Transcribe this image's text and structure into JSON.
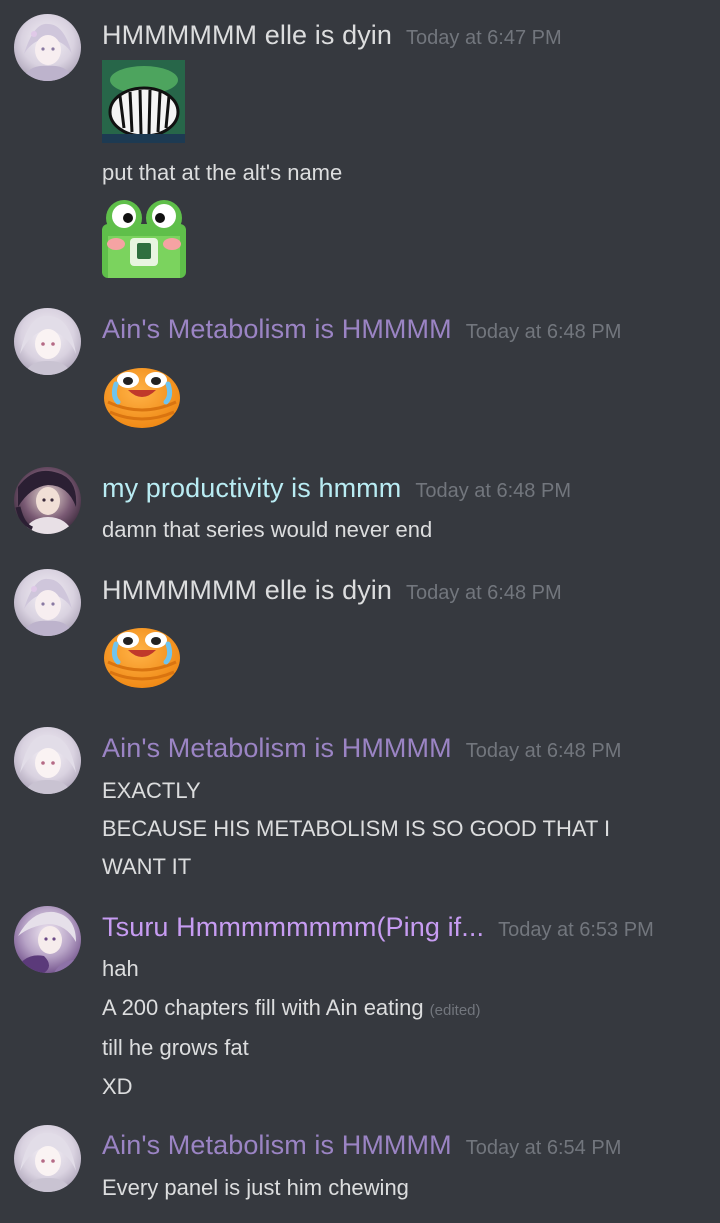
{
  "colors": {
    "background": "#36393f",
    "name_white": "#dcddde",
    "name_purple": "#9b84c4",
    "name_cyan": "#b9ecf3",
    "name_lilac": "#c79cf2",
    "timestamp": "#72767d"
  },
  "messages": [
    {
      "author": "HMMMMMM elle is dyin",
      "timestamp": "Today at 6:47 PM",
      "caption": "put that at the alt's name",
      "emojis": [
        "grimacing-pepe-emoji",
        "shocked-frog-emoji"
      ]
    },
    {
      "author": "Ain's Metabolism is HMMMM",
      "timestamp": "Today at 6:48 PM",
      "emojis": [
        "crying-laughing-blob-emoji"
      ]
    },
    {
      "author": "my productivity is hmmm",
      "timestamp": "Today at 6:48 PM",
      "lines": [
        "damn that series would never end"
      ]
    },
    {
      "author": "HMMMMMM elle is dyin",
      "timestamp": "Today at 6:48 PM",
      "emojis": [
        "crying-laughing-blob-emoji"
      ]
    },
    {
      "author": "Ain's Metabolism is HMMMM",
      "timestamp": "Today at 6:48 PM",
      "lines": [
        "EXACTLY",
        "BECAUSE HIS METABOLISM IS SO GOOD THAT I",
        "WANT IT"
      ]
    },
    {
      "author": "Tsuru Hmmmmmmmm(Ping if...",
      "timestamp": "Today at 6:53 PM",
      "lines": [
        "hah",
        "A 200 chapters fill with Ain eating",
        "till he grows fat",
        "XD"
      ],
      "edited_label": "(edited)"
    },
    {
      "author": "Ain's Metabolism is HMMMM",
      "timestamp": "Today at 6:54 PM",
      "lines": [
        "Every panel is just him chewing"
      ]
    }
  ]
}
